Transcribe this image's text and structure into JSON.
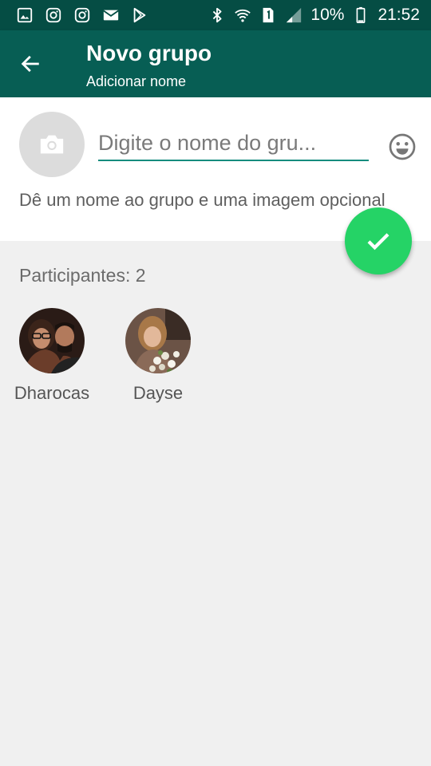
{
  "status_bar": {
    "battery": "10%",
    "time": "21:52",
    "notification_icons": [
      "gallery-icon",
      "instagram-icon",
      "instagram-icon",
      "mail-icon",
      "play-store-icon"
    ],
    "system_icons": [
      "bluetooth-icon",
      "wifi-icon",
      "sim-1-icon",
      "signal-icon",
      "battery-icon"
    ]
  },
  "toolbar": {
    "title": "Novo grupo",
    "subtitle": "Adicionar nome",
    "back_icon": "arrow-back-icon"
  },
  "group_form": {
    "photo_icon": "camera-icon",
    "name_placeholder": "Digite o nome do gru...",
    "emoji_icon": "emoji-icon",
    "hint": "Dê um nome ao grupo e uma imagem opcional"
  },
  "fab": {
    "icon": "check-icon"
  },
  "participants": {
    "label": "Participantes: 2",
    "items": [
      {
        "name": "Dharocas"
      },
      {
        "name": "Dayse"
      }
    ]
  },
  "colors": {
    "status_bar": "#054d44",
    "toolbar": "#075e54",
    "accent": "#128c7e",
    "fab": "#25d366",
    "background": "#f0f0f0"
  }
}
